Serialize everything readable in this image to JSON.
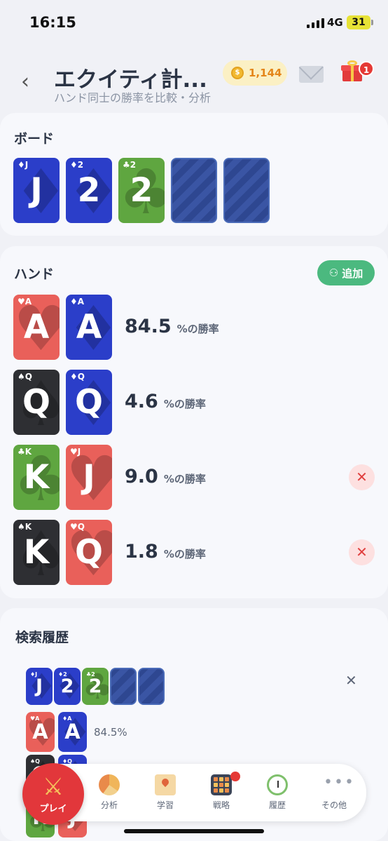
{
  "status": {
    "time": "16:15",
    "network": "4G",
    "battery": "31"
  },
  "header": {
    "title": "エクイティ計...",
    "subtitle": "ハンド同士の勝率を比較・分析",
    "coins": "1,144",
    "gift_badge": "1"
  },
  "board": {
    "title": "ボード",
    "cards": [
      {
        "rank": "J",
        "corner": "♦J",
        "suit": "diamond",
        "color": "blue"
      },
      {
        "rank": "2",
        "corner": "♦2",
        "suit": "diamond",
        "color": "blue"
      },
      {
        "rank": "2",
        "corner": "♣2",
        "suit": "club",
        "color": "green"
      },
      {
        "rank": "",
        "corner": "",
        "suit": "back",
        "color": "back"
      },
      {
        "rank": "",
        "corner": "",
        "suit": "back",
        "color": "back"
      }
    ]
  },
  "hands": {
    "title": "ハンド",
    "add_label": "追加",
    "win_label": "%の勝率",
    "rows": [
      {
        "equity": "84.5",
        "removable": false,
        "cards": [
          {
            "rank": "A",
            "corner": "♥A",
            "suit": "heart",
            "color": "red"
          },
          {
            "rank": "A",
            "corner": "♦A",
            "suit": "diamond",
            "color": "blue"
          }
        ]
      },
      {
        "equity": "4.6",
        "removable": false,
        "cards": [
          {
            "rank": "Q",
            "corner": "♠Q",
            "suit": "spade",
            "color": "black"
          },
          {
            "rank": "Q",
            "corner": "♦Q",
            "suit": "diamond",
            "color": "blue"
          }
        ]
      },
      {
        "equity": "9.0",
        "removable": true,
        "cards": [
          {
            "rank": "K",
            "corner": "♣K",
            "suit": "club",
            "color": "green"
          },
          {
            "rank": "J",
            "corner": "♥J",
            "suit": "heart",
            "color": "red"
          }
        ]
      },
      {
        "equity": "1.8",
        "removable": true,
        "cards": [
          {
            "rank": "K",
            "corner": "♠K",
            "suit": "spade",
            "color": "black"
          },
          {
            "rank": "Q",
            "corner": "♥Q",
            "suit": "heart",
            "color": "red"
          }
        ]
      }
    ]
  },
  "history": {
    "title": "検索履歴",
    "entry_equity": "84.5%",
    "board": [
      {
        "rank": "J",
        "corner": "♦J",
        "suit": "diamond",
        "color": "blue"
      },
      {
        "rank": "2",
        "corner": "♦2",
        "suit": "diamond",
        "color": "blue"
      },
      {
        "rank": "2",
        "corner": "♣2",
        "suit": "club",
        "color": "green"
      },
      {
        "rank": "",
        "corner": "",
        "suit": "back",
        "color": "back"
      },
      {
        "rank": "",
        "corner": "",
        "suit": "back",
        "color": "back"
      }
    ],
    "hand1": [
      {
        "rank": "A",
        "corner": "♥A",
        "suit": "heart",
        "color": "red"
      },
      {
        "rank": "A",
        "corner": "♦A",
        "suit": "diamond",
        "color": "blue"
      }
    ],
    "hand2": [
      {
        "rank": "Q",
        "corner": "♠Q",
        "suit": "spade",
        "color": "black"
      },
      {
        "rank": "Q",
        "corner": "♦Q",
        "suit": "diamond",
        "color": "blue"
      }
    ],
    "hand3": [
      {
        "rank": "K",
        "corner": "♣K",
        "suit": "club",
        "color": "green"
      },
      {
        "rank": "J",
        "corner": "♥J",
        "suit": "heart",
        "color": "red"
      }
    ]
  },
  "nav": {
    "play": "プレイ",
    "items": [
      "分析",
      "学習",
      "戦略",
      "履歴",
      "その他"
    ]
  },
  "colors": {
    "accent_green": "#4bb97f",
    "play_red": "#e2373b",
    "card_blue": "#2b3ec9",
    "card_red": "#e9605a",
    "card_green": "#5fa640",
    "card_black": "#2e2f33"
  }
}
